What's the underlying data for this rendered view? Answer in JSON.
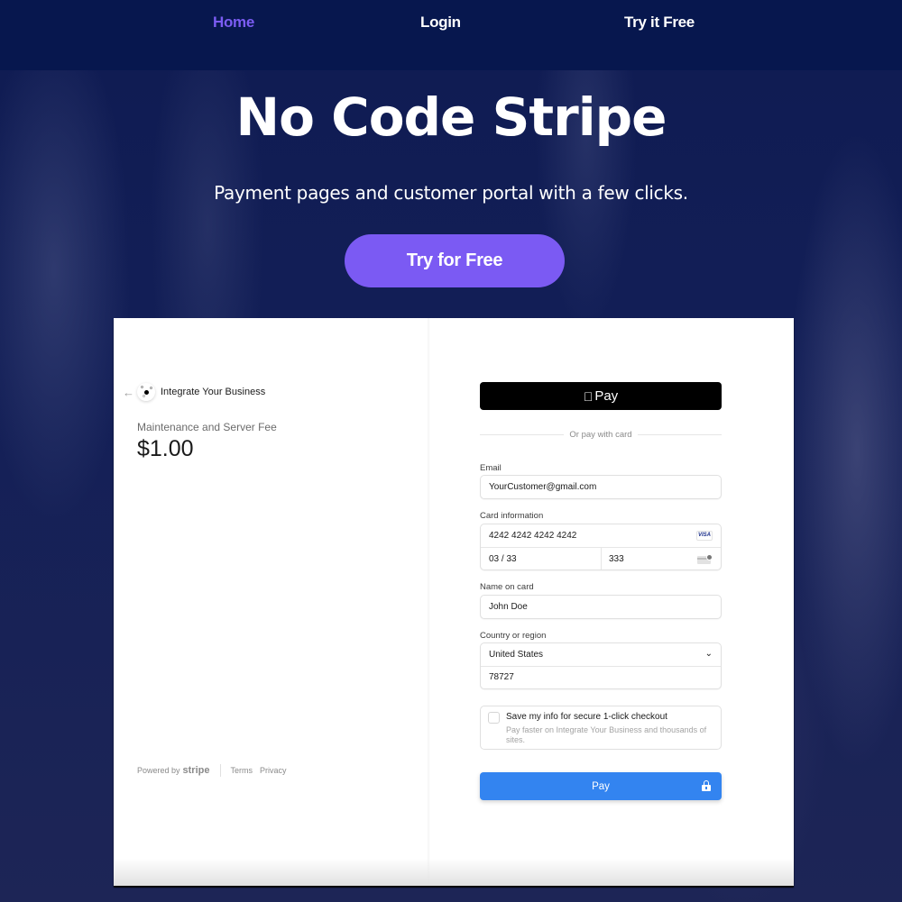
{
  "nav": {
    "items": [
      {
        "label": "Home",
        "active": true
      },
      {
        "label": "Login",
        "active": false
      },
      {
        "label": "Try it Free",
        "active": false
      }
    ]
  },
  "hero": {
    "title": "No Code Stripe",
    "subtitle": "Payment pages and customer portal with a few clicks.",
    "cta_label": "Try for Free"
  },
  "checkout": {
    "merchant_name": "Integrate Your Business",
    "product_name": "Maintenance and Server Fee",
    "price": "$1.00",
    "footer": {
      "powered_by": "Powered by",
      "brand": "stripe",
      "terms": "Terms",
      "privacy": "Privacy"
    },
    "apple_pay_label": " Pay",
    "apple_pay_text": "Pay",
    "divider_text": "Or pay with card",
    "email": {
      "label": "Email",
      "value": "YourCustomer@gmail.com"
    },
    "card": {
      "label": "Card information",
      "number": "4242 4242 4242 4242",
      "brand_badge": "VISA",
      "expiry": "03 / 33",
      "cvc": "333"
    },
    "name": {
      "label": "Name on card",
      "value": "John Doe"
    },
    "country": {
      "label": "Country or region",
      "selected": "United States",
      "zip": "78727"
    },
    "save_info": {
      "checked": false,
      "title": "Save my info for secure 1-click checkout",
      "description": "Pay faster on Integrate Your Business and thousands of sites."
    },
    "pay_label": "Pay"
  },
  "colors": {
    "nav_bg": "#07174e",
    "accent_purple": "#7b5af3",
    "pay_blue": "#3384f0"
  }
}
